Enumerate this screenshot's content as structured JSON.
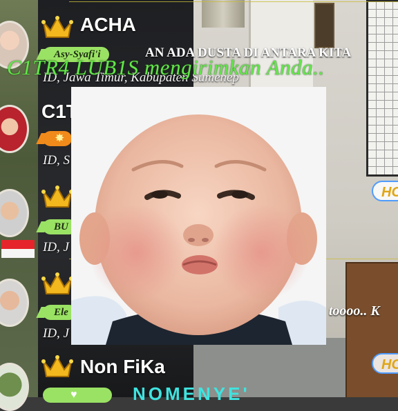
{
  "banner": {
    "text": "AN ADA DUSTA DI ANTARA KITA"
  },
  "gift_notification": {
    "text": "C1TR4 LUB1S mengirimkan Anda.."
  },
  "comment_overlay": {
    "text": "e toooo.. K"
  },
  "side_pill": {
    "label": "HO"
  },
  "bottom_text": {
    "text": "NOMENYE'"
  },
  "rows": [
    {
      "name": "ACHA",
      "badge": "Asy-Syafi'i",
      "location": "ID, Jawa Timur, Kabupaten Sumenep"
    },
    {
      "name": "C1T",
      "badge": "",
      "location": "ID, S"
    },
    {
      "name": "",
      "badge": "BU",
      "location": "ID, J"
    },
    {
      "name": "",
      "badge": "Ele",
      "location": "ID, J"
    },
    {
      "name": "Non FiKa",
      "badge": "",
      "location": ""
    }
  ],
  "colors": {
    "badge_green": "#9ae264",
    "gift_green": "#62e84a",
    "crown_gold": "#f2b81d",
    "pill_blue": "#4e9bff"
  },
  "icons": [
    "crown-icon",
    "flame-icon",
    "heart-icon",
    "indonesia-flag-icon"
  ]
}
